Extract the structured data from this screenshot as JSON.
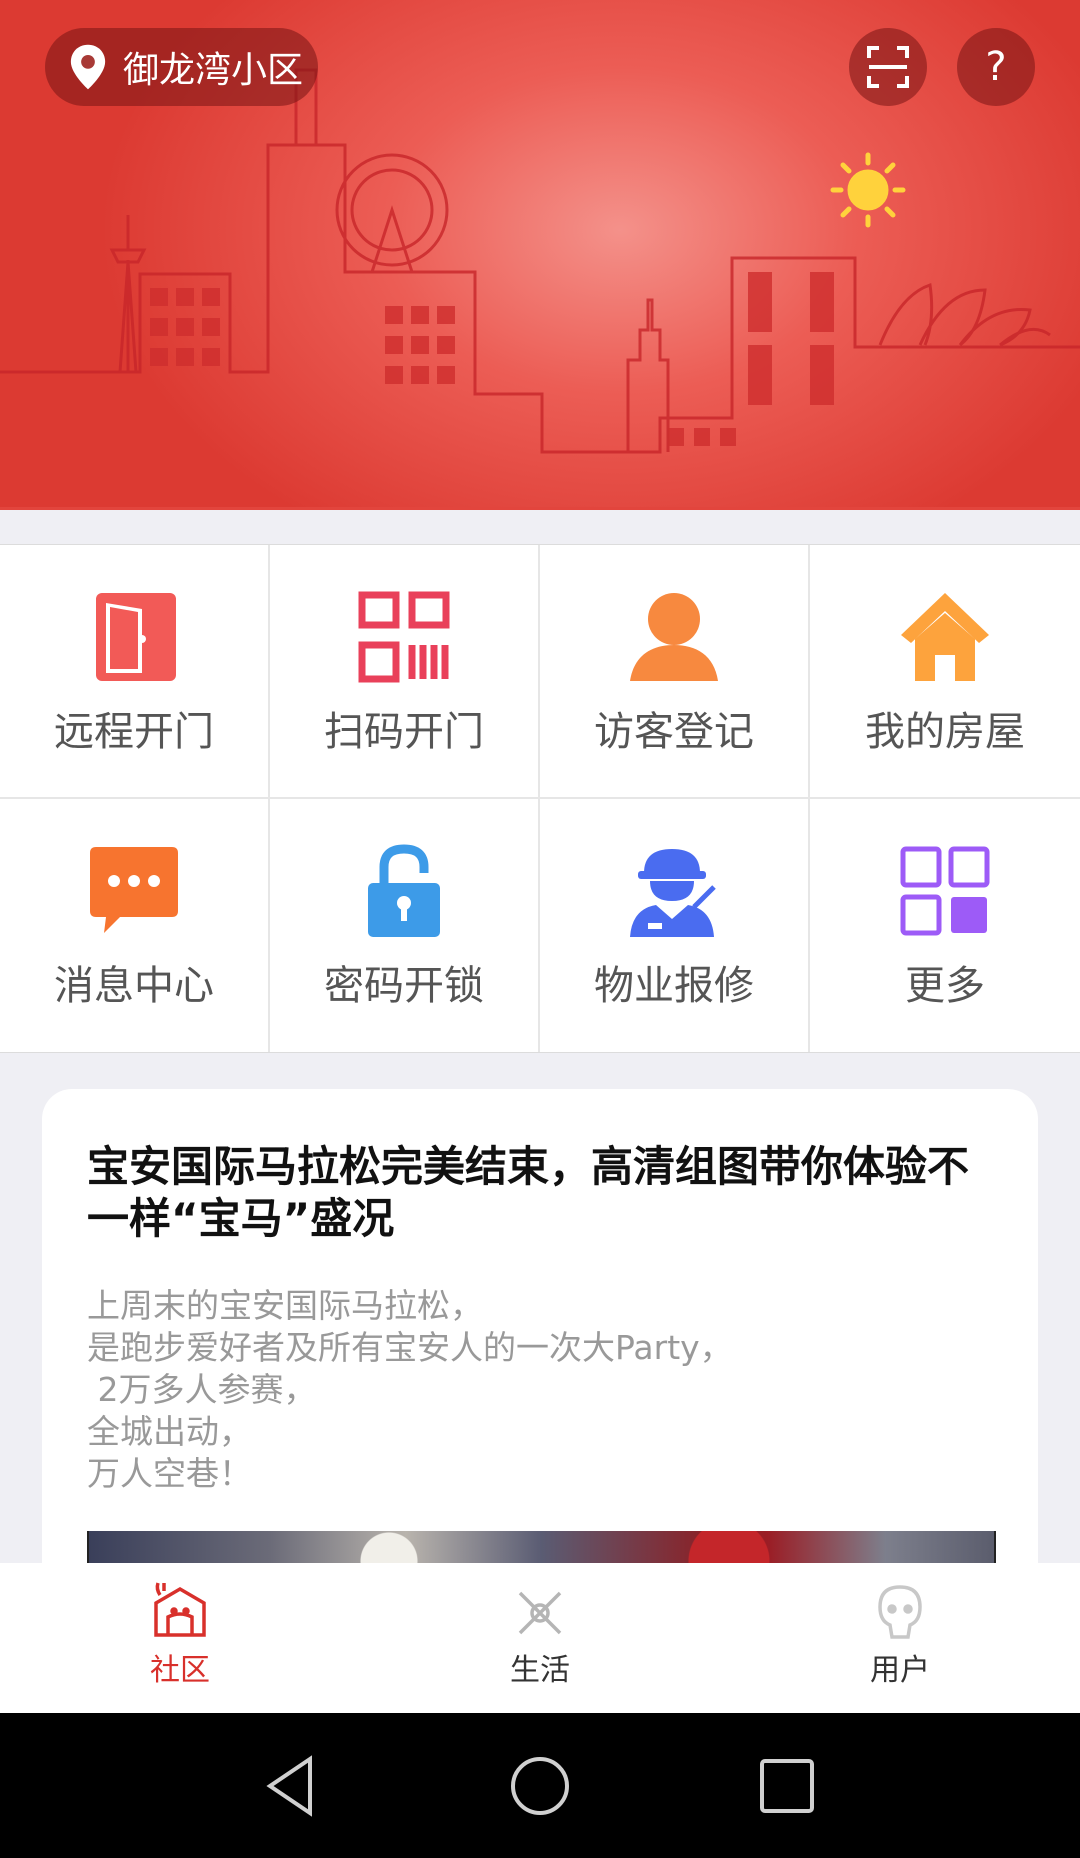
{
  "header": {
    "location": "御龙湾小区",
    "help_label": "?"
  },
  "services": [
    {
      "label": "远程开门",
      "icon": "door-icon",
      "color": "#f25a57"
    },
    {
      "label": "扫码开门",
      "icon": "qr-code-icon",
      "color": "#e9405a"
    },
    {
      "label": "访客登记",
      "icon": "person-icon",
      "color": "#f7893f"
    },
    {
      "label": "我的房屋",
      "icon": "house-icon",
      "color": "#fda33d"
    },
    {
      "label": "消息中心",
      "icon": "chat-bubble-icon",
      "color": "#f7742f"
    },
    {
      "label": "密码开锁",
      "icon": "unlock-icon",
      "color": "#3d9be8"
    },
    {
      "label": "物业报修",
      "icon": "repair-worker-icon",
      "color": "#4a6cf0"
    },
    {
      "label": "更多",
      "icon": "more-grid-icon",
      "color": "#9d5bf7"
    }
  ],
  "news": {
    "title": "宝安国际马拉松完美结束，高清组图带你体验不一样“宝马”盛况",
    "lines": [
      "上周末的宝安国际马拉松，",
      "是跑步爱好者及所有宝安人的一次大Party，",
      " 2万多人参赛，",
      "全城出动，",
      "万人空巷！"
    ]
  },
  "tabs": [
    {
      "label": "社区",
      "icon": "community-icon",
      "active": true
    },
    {
      "label": "生活",
      "icon": "life-icon",
      "active": false
    },
    {
      "label": "用户",
      "icon": "user-icon",
      "active": false
    }
  ],
  "colors": {
    "brand": "#d8302b",
    "hero_bg": "#e3463e",
    "inactive_tab": "#333333"
  }
}
